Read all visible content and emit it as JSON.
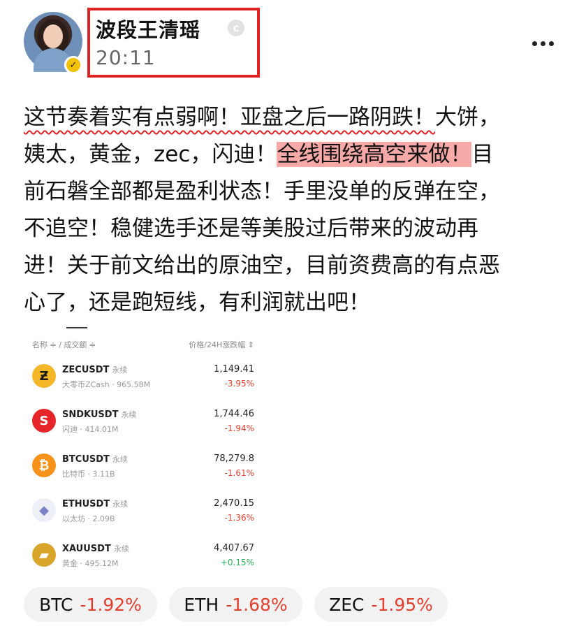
{
  "header": {
    "name": "波段王清瑶",
    "time": "20:11"
  },
  "post": {
    "lines": [
      [
        "这节奏着实有点弱啊！亚盘之后一路阴跌！",
        "大饼，"
      ],
      [
        "姨太，黄金，zec，闪迪！",
        "全线围绕高空来做！",
        "目"
      ],
      [
        "前石磐全部都是盈利状态！手里没单的反弹在空，"
      ],
      [
        "不追空！稳健选手还是等美股过后带来的波动再"
      ],
      [
        "进！关于前文给出的原油空，目前资费高的有点恶"
      ],
      [
        "心了，还是跑短线，有利润就出吧！"
      ]
    ]
  },
  "market": {
    "header_left": "名称 ≑ / 成交额 ≑",
    "header_right": "价格/24H涨跌幅 ⇕",
    "rows": [
      {
        "symbol": "ZECUSDT",
        "tag": "永续",
        "sub": "大零币ZCash · 965.58M",
        "price": "1,149.41",
        "change": "-3.95%",
        "dir": "down",
        "icon": "zcash-icon",
        "icon_char": "Ƶ",
        "color": "#f4b728",
        "fg": "#1a1a1a"
      },
      {
        "symbol": "SNDKUSDT",
        "tag": "永续",
        "sub": "闪迪 · 414.01M",
        "price": "1,744.46",
        "change": "-1.94%",
        "dir": "down",
        "icon": "sandisk-icon",
        "icon_char": "S",
        "color": "#e5252a",
        "fg": "#ffffff"
      },
      {
        "symbol": "BTCUSDT",
        "tag": "永续",
        "sub": "比特币 · 3.11B",
        "price": "78,279.8",
        "change": "-1.61%",
        "dir": "down",
        "icon": "bitcoin-icon",
        "icon_char": "₿",
        "color": "#f7931a",
        "fg": "#ffffff"
      },
      {
        "symbol": "ETHUSDT",
        "tag": "永续",
        "sub": "以太坊 · 2.09B",
        "price": "2,470.15",
        "change": "-1.36%",
        "dir": "down",
        "icon": "ethereum-icon",
        "icon_char": "◆",
        "color": "#eef0f8",
        "fg": "#7a82c8"
      },
      {
        "symbol": "XAUUSDT",
        "tag": "永续",
        "sub": "黄金 · 495.12M",
        "price": "4,407.67",
        "change": "+0.15%",
        "dir": "up",
        "icon": "gold-icon",
        "icon_char": "▰",
        "color": "#d9a62b",
        "fg": "#ffffff"
      }
    ]
  },
  "tickers": [
    {
      "sym": "BTC",
      "chg": "-1.92%"
    },
    {
      "sym": "ETH",
      "chg": "-1.68%"
    },
    {
      "sym": "ZEC",
      "chg": "-1.95%"
    }
  ]
}
